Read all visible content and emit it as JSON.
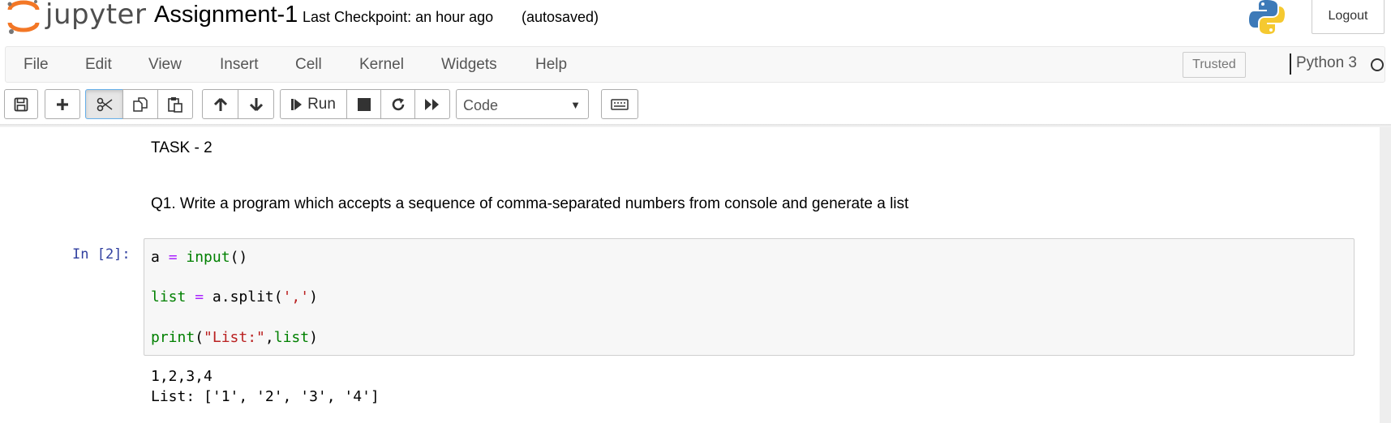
{
  "header": {
    "logo_text": "jupyter",
    "notebook_name": "Assignment-1",
    "checkpoint": "Last Checkpoint: an hour ago",
    "autosave_status": "(autosaved)",
    "logout_label": "Logout"
  },
  "menu": {
    "items": [
      "File",
      "Edit",
      "View",
      "Insert",
      "Cell",
      "Kernel",
      "Widgets",
      "Help"
    ],
    "trusted_label": "Trusted",
    "kernel_name": "Python 3"
  },
  "toolbar": {
    "run_label": "Run",
    "cell_type": "Code",
    "icons": [
      "save-icon",
      "plus-icon",
      "cut-icon",
      "copy-icon",
      "paste-icon",
      "arrow-up-icon",
      "arrow-down-icon",
      "step-forward-icon",
      "stop-icon",
      "restart-icon",
      "fast-forward-icon",
      "keyboard-icon"
    ]
  },
  "notebook": {
    "markdown": [
      "TASK - 2",
      "Q1. Write a program which accepts a sequence of comma-separated numbers from console and generate a list"
    ],
    "cell": {
      "prompt": "In [2]:",
      "code_lines": [
        {
          "var": "a",
          "eq": "=",
          "func": "input",
          "rest": "()"
        },
        {
          "func": "list",
          "eq": "=",
          "call": "a.split(",
          "str": "','",
          "close": ")"
        },
        {
          "func": "print",
          "open": "(",
          "str": "\"List:\"",
          "comma": ",",
          "arg": "list",
          "close": ")"
        }
      ],
      "output": [
        "1,2,3,4",
        "List: ['1', '2', '3', '4']"
      ]
    }
  },
  "colors": {
    "prompt": "#303f9f",
    "builtin": "#008000",
    "operator": "#aa22ff",
    "string": "#ba2121",
    "jupyter_orange": "#f37726"
  }
}
